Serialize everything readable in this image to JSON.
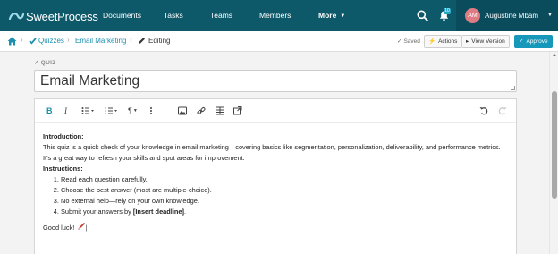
{
  "app": {
    "brand": "SweetProcess"
  },
  "nav": {
    "items": [
      "Documents",
      "Tasks",
      "Teams",
      "Members",
      "More"
    ],
    "notification_count": "10"
  },
  "user": {
    "initials": "AM",
    "name": "Augustine Mbam"
  },
  "breadcrumb": {
    "items": [
      "Quizzes",
      "Email Marketing",
      "Editing"
    ]
  },
  "actions": {
    "status": "Saved",
    "buttons": [
      "Actions",
      "View Version",
      "Approve"
    ]
  },
  "quiz": {
    "label": "QUIZ",
    "title": "Email Marketing"
  },
  "editor": {
    "toolbar": [
      "bold",
      "italic",
      "bulleted-list",
      "numbered-list",
      "paragraph-format",
      "more-vertical",
      "image",
      "link",
      "table",
      "embed",
      "undo",
      "redo"
    ],
    "content": {
      "intro_heading": "Introduction:",
      "intro_text": "This quiz is a quick check of your knowledge in email marketing—covering basics like segmentation, personalization, deliverability, and performance metrics. It's a great way to refresh your skills and spot areas for improvement.",
      "instructions_heading": "Instructions:",
      "steps": [
        "Read each question carefully.",
        "Choose the best answer (most are multiple-choice).",
        "No external help—rely on your own knowledge."
      ],
      "step4_prefix": "Submit your answers by ",
      "step4_bold": "[Insert deadline]",
      "step4_suffix": ".",
      "closing": "Good luck!"
    }
  },
  "colors": {
    "nav_bg": "#0d5869",
    "accent": "#1598b9",
    "link": "#1c8fae",
    "avatar": "#df7b83"
  }
}
